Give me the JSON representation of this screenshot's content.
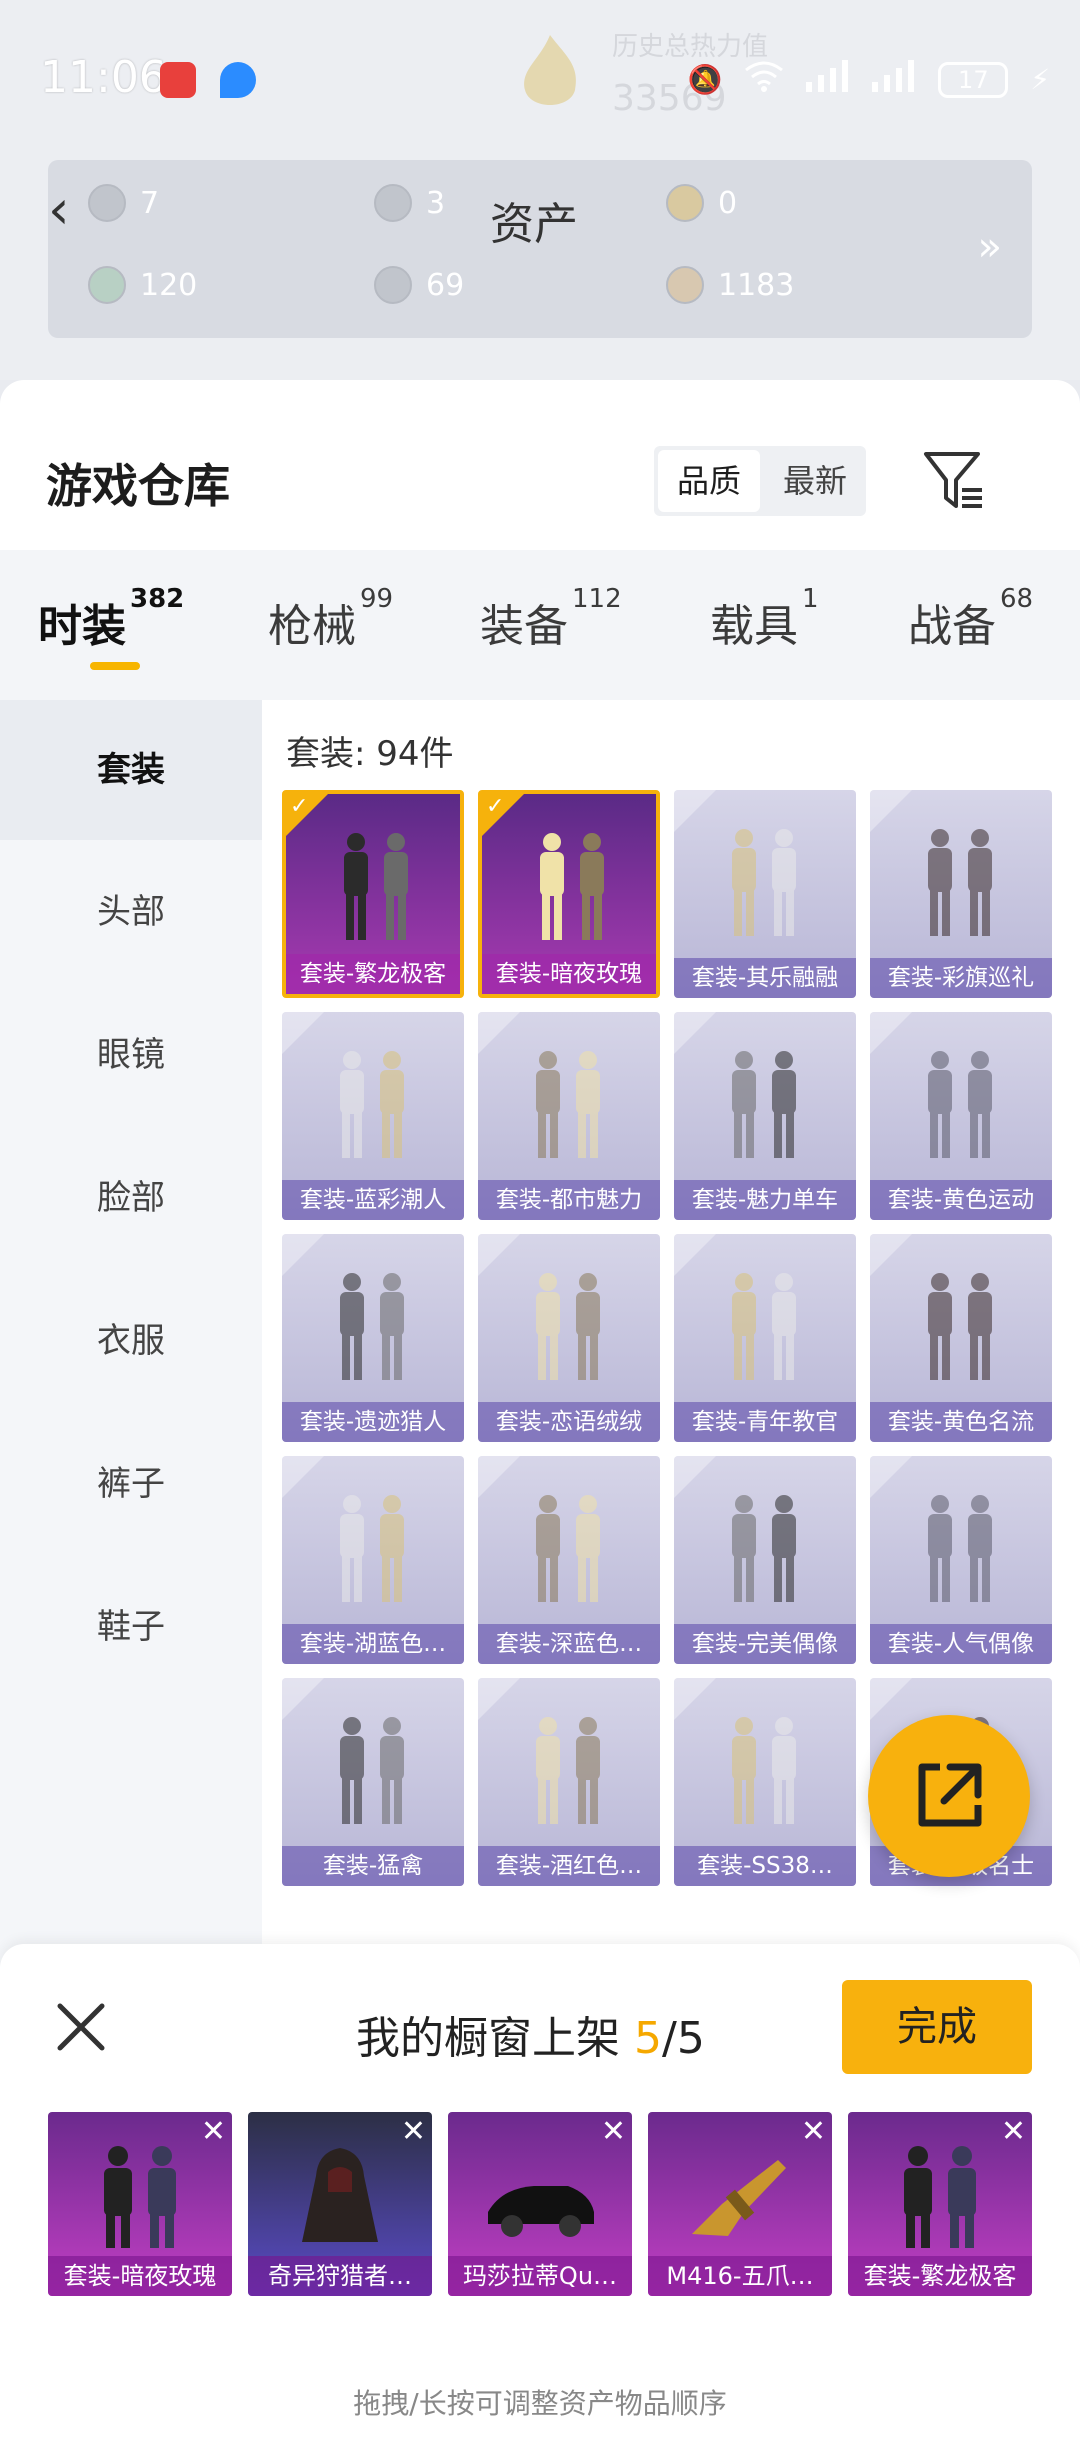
{
  "status_bar": {
    "time": "11:06",
    "battery": "17"
  },
  "background_page": {
    "heat_label": "历史总热力值",
    "heat_value": "33569",
    "asset_title": "资产",
    "assets": [
      {
        "value": "7"
      },
      {
        "value": "3"
      },
      {
        "value": "0"
      },
      {
        "value": "120"
      },
      {
        "value": "69"
      },
      {
        "value": "1183"
      }
    ],
    "more": "»"
  },
  "warehouse": {
    "title": "游戏仓库",
    "sort_options": [
      "品质",
      "最新"
    ],
    "sort_selected": "品质"
  },
  "tabs": [
    {
      "label": "时装",
      "count": "382"
    },
    {
      "label": "枪械",
      "count": "99"
    },
    {
      "label": "装备",
      "count": "112"
    },
    {
      "label": "载具",
      "count": "1"
    },
    {
      "label": "战备",
      "count": "68"
    }
  ],
  "categories": [
    "套装",
    "头部",
    "眼镜",
    "脸部",
    "衣服",
    "裤子",
    "鞋子"
  ],
  "grid_header": "套装: 94件",
  "items": [
    {
      "label": "套装-繁龙极客",
      "selected": true
    },
    {
      "label": "套装-暗夜玫瑰",
      "selected": true
    },
    {
      "label": "套装-其乐融融",
      "selected": false
    },
    {
      "label": "套装-彩旗巡礼",
      "selected": false
    },
    {
      "label": "套装-蓝彩潮人",
      "selected": false
    },
    {
      "label": "套装-都市魅力",
      "selected": false
    },
    {
      "label": "套装-魅力单车",
      "selected": false
    },
    {
      "label": "套装-黄色运动",
      "selected": false
    },
    {
      "label": "套装-遗迹猎人",
      "selected": false
    },
    {
      "label": "套装-恋语绒绒",
      "selected": false
    },
    {
      "label": "套装-青年教官",
      "selected": false
    },
    {
      "label": "套装-黄色名流",
      "selected": false
    },
    {
      "label": "套装-湖蓝色…",
      "selected": false
    },
    {
      "label": "套装-深蓝色…",
      "selected": false
    },
    {
      "label": "套装-完美偶像",
      "selected": false
    },
    {
      "label": "套装-人气偶像",
      "selected": false
    },
    {
      "label": "套装-猛禽",
      "selected": false
    },
    {
      "label": "套装-酒红色…",
      "selected": false
    },
    {
      "label": "套装-SS38…",
      "selected": false
    },
    {
      "label": "套装-…级名士",
      "selected": false
    }
  ],
  "showcase": {
    "title_prefix": "我的橱窗上架 ",
    "count_current": "5",
    "count_total": "/5",
    "done_label": "完成",
    "items": [
      {
        "label": "套装-暗夜玫瑰"
      },
      {
        "label": "奇异狩猎者…"
      },
      {
        "label": "玛莎拉蒂Qu…"
      },
      {
        "label": "M416-五爪…"
      },
      {
        "label": "套装-繁龙极客"
      }
    ],
    "hint": "拖拽/长按可调整资产物品顺序"
  }
}
